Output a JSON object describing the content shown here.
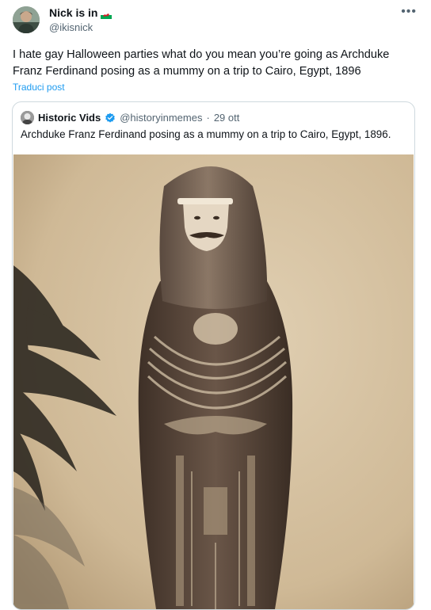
{
  "tweet": {
    "author_name": "Nick is in",
    "author_flag": "wales-flag",
    "author_handle": "@ikisnick",
    "more_icon": "more-icon",
    "body_line1": "I hate gay Halloween parties what do you mean you’re going as Archduke",
    "body_line2": "Franz Ferdinand posing as a mummy on a trip to Cairo, Egypt, 1896",
    "translate_label": "Traduci post"
  },
  "quote": {
    "author_name": "Historic Vids",
    "verified_icon": "verified-badge-icon",
    "author_handle": "@historyinmemes",
    "separator": "·",
    "date": "29 ott",
    "text": "Archduke Franz Ferdinand posing as a mummy on a trip to Cairo, Egypt, 1896.",
    "image_subject": "sepia photo of man in mummy sarcophagus costume beside palm"
  },
  "colors": {
    "link": "#1d9bf0",
    "secondary_text": "#536471",
    "border": "#cfd9de",
    "sepia_background": "#d8c4a4"
  }
}
